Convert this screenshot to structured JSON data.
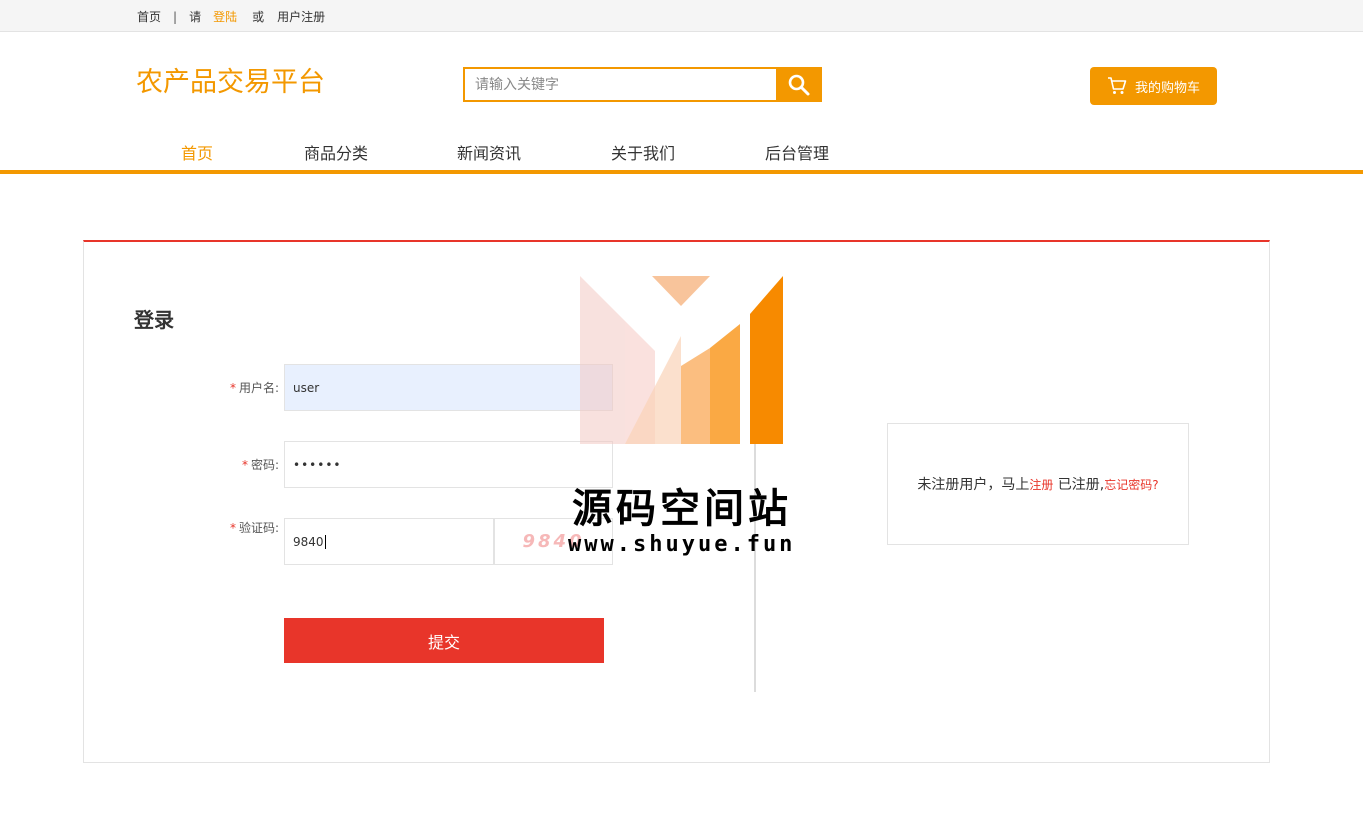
{
  "topbar": {
    "home": "首页",
    "separator": "|",
    "please": "请",
    "login": "登陆",
    "or": "或",
    "register": "用户注册"
  },
  "header": {
    "brand": "农产品交易平台",
    "search_placeholder": "请输入关键字",
    "cart_label": "我的购物车"
  },
  "nav": {
    "items": [
      "首页",
      "商品分类",
      "新闻资讯",
      "关于我们",
      "后台管理"
    ],
    "active": "首页"
  },
  "login_form": {
    "title": "登录",
    "required_mark": "*",
    "username_label": "用户名:",
    "username_value": "user",
    "password_label": "密码:",
    "password_value": "••••••",
    "captcha_label": "验证码:",
    "captcha_value": "9840",
    "captcha_image_text": "9840",
    "submit_label": "提交"
  },
  "register_box": {
    "unregistered_text": "未注册用户，马上",
    "register_link": "注册",
    "registered_text": " 已注册,",
    "forgot_link": "忘记密码?"
  },
  "watermark": {
    "title": "源码空间站",
    "url": "www.shuyue.fun"
  },
  "colors": {
    "accent": "#f39800",
    "danger": "#e8352a",
    "autofill_bg": "#e8f0fe"
  }
}
